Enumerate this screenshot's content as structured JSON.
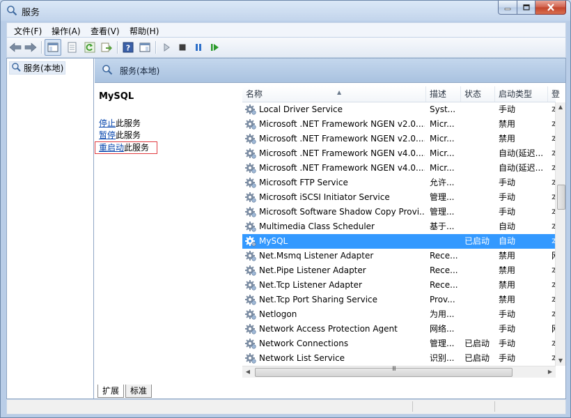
{
  "window": {
    "title": "服务"
  },
  "menu": [
    "文件(F)",
    "操作(A)",
    "查看(V)",
    "帮助(H)"
  ],
  "tree": {
    "root_label": "服务(本地)"
  },
  "pane": {
    "header_title": "服务(本地)",
    "service_name": "MySQL",
    "actions": [
      {
        "link": "停止",
        "suffix": "此服务"
      },
      {
        "link": "暂停",
        "suffix": "此服务"
      },
      {
        "link": "重启动",
        "suffix": "此服务"
      }
    ]
  },
  "list": {
    "columns": [
      "名称",
      "描述",
      "状态",
      "启动类型",
      "登"
    ],
    "rows": [
      {
        "name": "Local Driver Service",
        "desc": "Syst...",
        "status": "",
        "startup": "手动",
        "logon": "本"
      },
      {
        "name": "Microsoft .NET Framework NGEN v2.0....",
        "desc": "Micr...",
        "status": "",
        "startup": "禁用",
        "logon": "本"
      },
      {
        "name": "Microsoft .NET Framework NGEN v2.0....",
        "desc": "Micr...",
        "status": "",
        "startup": "禁用",
        "logon": "本"
      },
      {
        "name": "Microsoft .NET Framework NGEN v4.0....",
        "desc": "Micr...",
        "status": "",
        "startup": "自动(延迟...",
        "logon": "本"
      },
      {
        "name": "Microsoft .NET Framework NGEN v4.0....",
        "desc": "Micr...",
        "status": "",
        "startup": "自动(延迟...",
        "logon": "本"
      },
      {
        "name": "Microsoft FTP Service",
        "desc": "允许...",
        "status": "",
        "startup": "手动",
        "logon": "本"
      },
      {
        "name": "Microsoft iSCSI Initiator Service",
        "desc": "管理...",
        "status": "",
        "startup": "手动",
        "logon": "本"
      },
      {
        "name": "Microsoft Software Shadow Copy Provi...",
        "desc": "管理...",
        "status": "",
        "startup": "手动",
        "logon": "本"
      },
      {
        "name": "Multimedia Class Scheduler",
        "desc": "基于...",
        "status": "",
        "startup": "自动",
        "logon": "本"
      },
      {
        "name": "MySQL",
        "desc": "",
        "status": "已启动",
        "startup": "自动",
        "logon": "本",
        "selected": true
      },
      {
        "name": "Net.Msmq Listener Adapter",
        "desc": "Rece...",
        "status": "",
        "startup": "禁用",
        "logon": "网"
      },
      {
        "name": "Net.Pipe Listener Adapter",
        "desc": "Rece...",
        "status": "",
        "startup": "禁用",
        "logon": "本"
      },
      {
        "name": "Net.Tcp Listener Adapter",
        "desc": "Rece...",
        "status": "",
        "startup": "禁用",
        "logon": "本"
      },
      {
        "name": "Net.Tcp Port Sharing Service",
        "desc": "Prov...",
        "status": "",
        "startup": "禁用",
        "logon": "本"
      },
      {
        "name": "Netlogon",
        "desc": "为用...",
        "status": "",
        "startup": "手动",
        "logon": "本"
      },
      {
        "name": "Network Access Protection Agent",
        "desc": "网络...",
        "status": "",
        "startup": "手动",
        "logon": "网"
      },
      {
        "name": "Network Connections",
        "desc": "管理...",
        "status": "已启动",
        "startup": "手动",
        "logon": "本"
      },
      {
        "name": "Network List Service",
        "desc": "识别...",
        "status": "已启动",
        "startup": "手动",
        "logon": "本"
      }
    ]
  },
  "tabs": [
    "扩展",
    "标准"
  ],
  "hscroll_grip": "III",
  "colors": {
    "selection": "#3399ff",
    "link": "#0645ad",
    "highlight_box": "#e0393e"
  }
}
